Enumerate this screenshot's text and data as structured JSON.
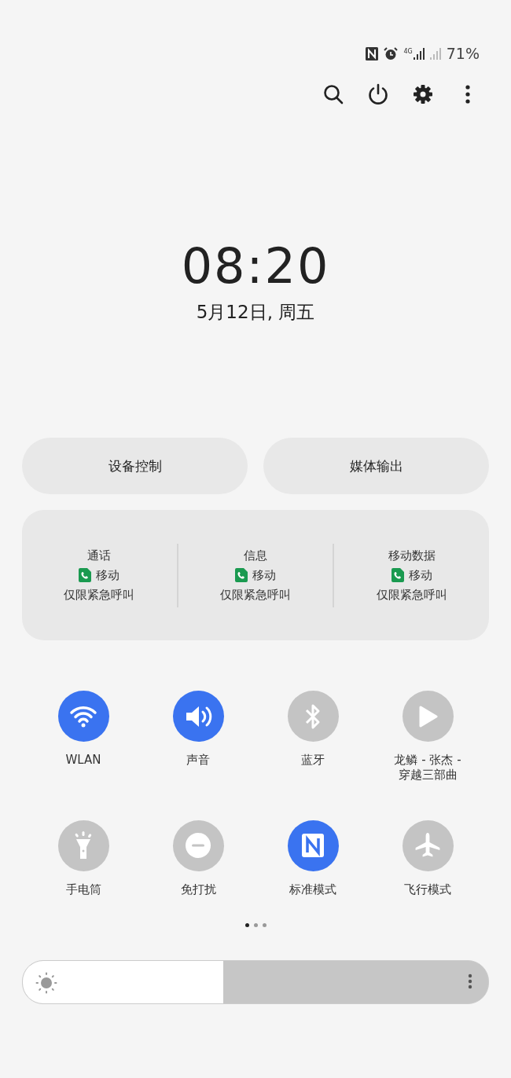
{
  "status_bar": {
    "network": "4G",
    "battery": "71%"
  },
  "clock": {
    "time": "08:20",
    "date": "5月12日, 周五"
  },
  "panels": [
    "设备控制",
    "媒体输出"
  ],
  "sim_info": [
    {
      "title": "通话",
      "carrier": "移动",
      "status": "仅限紧急呼叫"
    },
    {
      "title": "信息",
      "carrier": "移动",
      "status": "仅限紧急呼叫"
    },
    {
      "title": "移动数据",
      "carrier": "移动",
      "status": "仅限紧急呼叫"
    }
  ],
  "tiles": [
    {
      "kind": "wifi",
      "label": "WLAN",
      "on": true
    },
    {
      "kind": "sound",
      "label": "声音",
      "on": true
    },
    {
      "kind": "bluetooth",
      "label": "蓝牙",
      "on": false
    },
    {
      "kind": "play",
      "label": "龙鳞 - 张杰 - 穿越三部曲",
      "on": false
    },
    {
      "kind": "flashlight",
      "label": "手电筒",
      "on": false
    },
    {
      "kind": "dnd",
      "label": "免打扰",
      "on": false
    },
    {
      "kind": "nfc",
      "label": "标准模式",
      "on": true
    },
    {
      "kind": "airplane",
      "label": "飞行模式",
      "on": false
    }
  ],
  "pages": [
    {
      "selected": true
    },
    {
      "selected": false
    },
    {
      "selected": false
    }
  ],
  "brightness": {
    "level": 0.43
  }
}
